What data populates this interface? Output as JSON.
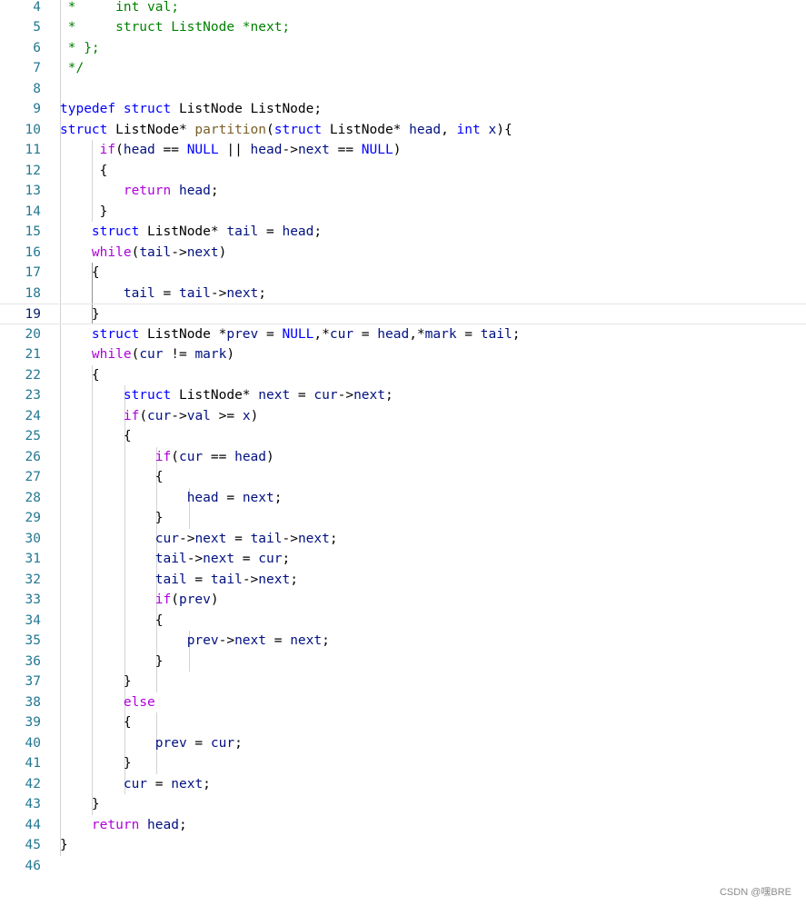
{
  "editor": {
    "language": "c",
    "first_line": 4,
    "current_line": 19,
    "colors": {
      "kw": "#0000ff",
      "ctl": "#af00db",
      "fn": "#795e26",
      "var": "#001080",
      "cm": "#008000",
      "pl": "#000000",
      "line_number": "#237893",
      "line_number_active": "#0b216f"
    },
    "lines": [
      {
        "number": "4",
        "indent": "",
        "tokens": [
          [
            "cm",
            " *     int val;"
          ]
        ]
      },
      {
        "number": "5",
        "indent": "",
        "tokens": [
          [
            "cm",
            " *     struct ListNode *next;"
          ]
        ]
      },
      {
        "number": "6",
        "indent": "",
        "tokens": [
          [
            "cm",
            " * };"
          ]
        ]
      },
      {
        "number": "7",
        "indent": "",
        "tokens": [
          [
            "cm",
            " */"
          ]
        ]
      },
      {
        "number": "8",
        "indent": "",
        "tokens": []
      },
      {
        "number": "9",
        "indent": "",
        "tokens": [
          [
            "kw",
            "typedef"
          ],
          [
            "pl",
            " "
          ],
          [
            "kw",
            "struct"
          ],
          [
            "pl",
            " ListNode ListNode;"
          ]
        ]
      },
      {
        "number": "10",
        "indent": "",
        "tokens": [
          [
            "kw",
            "struct"
          ],
          [
            "pl",
            " ListNode* "
          ],
          [
            "fn",
            "partition"
          ],
          [
            "pl",
            "("
          ],
          [
            "kw",
            "struct"
          ],
          [
            "pl",
            " ListNode* "
          ],
          [
            "var",
            "head"
          ],
          [
            "pl",
            ", "
          ],
          [
            "kw",
            "int"
          ],
          [
            "pl",
            " "
          ],
          [
            "var",
            "x"
          ],
          [
            "pl",
            "){"
          ]
        ]
      },
      {
        "number": "11",
        "indent": "     ",
        "tokens": [
          [
            "ctl",
            "if"
          ],
          [
            "pl",
            "("
          ],
          [
            "var",
            "head"
          ],
          [
            "pl",
            " == "
          ],
          [
            "kw",
            "NULL"
          ],
          [
            "pl",
            " || "
          ],
          [
            "var",
            "head"
          ],
          [
            "pl",
            "->"
          ],
          [
            "var",
            "next"
          ],
          [
            "pl",
            " == "
          ],
          [
            "kw",
            "NULL"
          ],
          [
            "pl",
            ")"
          ]
        ]
      },
      {
        "number": "12",
        "indent": "     ",
        "tokens": [
          [
            "pl",
            "{"
          ]
        ]
      },
      {
        "number": "13",
        "indent": "        ",
        "tokens": [
          [
            "ctl",
            "return"
          ],
          [
            "pl",
            " "
          ],
          [
            "var",
            "head"
          ],
          [
            "pl",
            ";"
          ]
        ]
      },
      {
        "number": "14",
        "indent": "     ",
        "tokens": [
          [
            "pl",
            "}"
          ]
        ]
      },
      {
        "number": "15",
        "indent": "    ",
        "tokens": [
          [
            "kw",
            "struct"
          ],
          [
            "pl",
            " ListNode* "
          ],
          [
            "var",
            "tail"
          ],
          [
            "pl",
            " = "
          ],
          [
            "var",
            "head"
          ],
          [
            "pl",
            ";"
          ]
        ]
      },
      {
        "number": "16",
        "indent": "    ",
        "tokens": [
          [
            "ctl",
            "while"
          ],
          [
            "pl",
            "("
          ],
          [
            "var",
            "tail"
          ],
          [
            "pl",
            "->"
          ],
          [
            "var",
            "next"
          ],
          [
            "pl",
            ")"
          ]
        ]
      },
      {
        "number": "17",
        "indent": "    ",
        "tokens": [
          [
            "pl",
            "{"
          ]
        ]
      },
      {
        "number": "18",
        "indent": "        ",
        "tokens": [
          [
            "var",
            "tail"
          ],
          [
            "pl",
            " = "
          ],
          [
            "var",
            "tail"
          ],
          [
            "pl",
            "->"
          ],
          [
            "var",
            "next"
          ],
          [
            "pl",
            ";"
          ]
        ]
      },
      {
        "number": "19",
        "indent": "    ",
        "tokens": [
          [
            "pl",
            "}"
          ]
        ]
      },
      {
        "number": "20",
        "indent": "    ",
        "tokens": [
          [
            "kw",
            "struct"
          ],
          [
            "pl",
            " ListNode *"
          ],
          [
            "var",
            "prev"
          ],
          [
            "pl",
            " = "
          ],
          [
            "kw",
            "NULL"
          ],
          [
            "pl",
            ",*"
          ],
          [
            "var",
            "cur"
          ],
          [
            "pl",
            " = "
          ],
          [
            "var",
            "head"
          ],
          [
            "pl",
            ",*"
          ],
          [
            "var",
            "mark"
          ],
          [
            "pl",
            " = "
          ],
          [
            "var",
            "tail"
          ],
          [
            "pl",
            ";"
          ]
        ]
      },
      {
        "number": "21",
        "indent": "    ",
        "tokens": [
          [
            "ctl",
            "while"
          ],
          [
            "pl",
            "("
          ],
          [
            "var",
            "cur"
          ],
          [
            "pl",
            " != "
          ],
          [
            "var",
            "mark"
          ],
          [
            "pl",
            ")"
          ]
        ]
      },
      {
        "number": "22",
        "indent": "    ",
        "tokens": [
          [
            "pl",
            "{"
          ]
        ]
      },
      {
        "number": "23",
        "indent": "        ",
        "tokens": [
          [
            "kw",
            "struct"
          ],
          [
            "pl",
            " ListNode* "
          ],
          [
            "var",
            "next"
          ],
          [
            "pl",
            " = "
          ],
          [
            "var",
            "cur"
          ],
          [
            "pl",
            "->"
          ],
          [
            "var",
            "next"
          ],
          [
            "pl",
            ";"
          ]
        ]
      },
      {
        "number": "24",
        "indent": "        ",
        "tokens": [
          [
            "ctl",
            "if"
          ],
          [
            "pl",
            "("
          ],
          [
            "var",
            "cur"
          ],
          [
            "pl",
            "->"
          ],
          [
            "var",
            "val"
          ],
          [
            "pl",
            " >= "
          ],
          [
            "var",
            "x"
          ],
          [
            "pl",
            ")"
          ]
        ]
      },
      {
        "number": "25",
        "indent": "        ",
        "tokens": [
          [
            "pl",
            "{"
          ]
        ]
      },
      {
        "number": "26",
        "indent": "            ",
        "tokens": [
          [
            "ctl",
            "if"
          ],
          [
            "pl",
            "("
          ],
          [
            "var",
            "cur"
          ],
          [
            "pl",
            " == "
          ],
          [
            "var",
            "head"
          ],
          [
            "pl",
            ")"
          ]
        ]
      },
      {
        "number": "27",
        "indent": "            ",
        "tokens": [
          [
            "pl",
            "{"
          ]
        ]
      },
      {
        "number": "28",
        "indent": "                ",
        "tokens": [
          [
            "var",
            "head"
          ],
          [
            "pl",
            " = "
          ],
          [
            "var",
            "next"
          ],
          [
            "pl",
            ";"
          ]
        ]
      },
      {
        "number": "29",
        "indent": "            ",
        "tokens": [
          [
            "pl",
            "}"
          ]
        ]
      },
      {
        "number": "30",
        "indent": "            ",
        "tokens": [
          [
            "var",
            "cur"
          ],
          [
            "pl",
            "->"
          ],
          [
            "var",
            "next"
          ],
          [
            "pl",
            " = "
          ],
          [
            "var",
            "tail"
          ],
          [
            "pl",
            "->"
          ],
          [
            "var",
            "next"
          ],
          [
            "pl",
            ";"
          ]
        ]
      },
      {
        "number": "31",
        "indent": "            ",
        "tokens": [
          [
            "var",
            "tail"
          ],
          [
            "pl",
            "->"
          ],
          [
            "var",
            "next"
          ],
          [
            "pl",
            " = "
          ],
          [
            "var",
            "cur"
          ],
          [
            "pl",
            ";"
          ]
        ]
      },
      {
        "number": "32",
        "indent": "            ",
        "tokens": [
          [
            "var",
            "tail"
          ],
          [
            "pl",
            " = "
          ],
          [
            "var",
            "tail"
          ],
          [
            "pl",
            "->"
          ],
          [
            "var",
            "next"
          ],
          [
            "pl",
            ";"
          ]
        ]
      },
      {
        "number": "33",
        "indent": "            ",
        "tokens": [
          [
            "ctl",
            "if"
          ],
          [
            "pl",
            "("
          ],
          [
            "var",
            "prev"
          ],
          [
            "pl",
            ")"
          ]
        ]
      },
      {
        "number": "34",
        "indent": "            ",
        "tokens": [
          [
            "pl",
            "{"
          ]
        ]
      },
      {
        "number": "35",
        "indent": "                ",
        "tokens": [
          [
            "var",
            "prev"
          ],
          [
            "pl",
            "->"
          ],
          [
            "var",
            "next"
          ],
          [
            "pl",
            " = "
          ],
          [
            "var",
            "next"
          ],
          [
            "pl",
            ";"
          ]
        ]
      },
      {
        "number": "36",
        "indent": "            ",
        "tokens": [
          [
            "pl",
            "}"
          ]
        ]
      },
      {
        "number": "37",
        "indent": "        ",
        "tokens": [
          [
            "pl",
            "}"
          ]
        ]
      },
      {
        "number": "38",
        "indent": "        ",
        "tokens": [
          [
            "ctl",
            "else"
          ]
        ]
      },
      {
        "number": "39",
        "indent": "        ",
        "tokens": [
          [
            "pl",
            "{"
          ]
        ]
      },
      {
        "number": "40",
        "indent": "            ",
        "tokens": [
          [
            "var",
            "prev"
          ],
          [
            "pl",
            " = "
          ],
          [
            "var",
            "cur"
          ],
          [
            "pl",
            ";"
          ]
        ]
      },
      {
        "number": "41",
        "indent": "        ",
        "tokens": [
          [
            "pl",
            "}"
          ]
        ]
      },
      {
        "number": "42",
        "indent": "        ",
        "tokens": [
          [
            "var",
            "cur"
          ],
          [
            "pl",
            " = "
          ],
          [
            "var",
            "next"
          ],
          [
            "pl",
            ";"
          ]
        ]
      },
      {
        "number": "43",
        "indent": "    ",
        "tokens": [
          [
            "pl",
            "}"
          ]
        ]
      },
      {
        "number": "44",
        "indent": "    ",
        "tokens": [
          [
            "ctl",
            "return"
          ],
          [
            "pl",
            " "
          ],
          [
            "var",
            "head"
          ],
          [
            "pl",
            ";"
          ]
        ]
      },
      {
        "number": "45",
        "indent": "",
        "tokens": [
          [
            "pl",
            "}"
          ]
        ]
      },
      {
        "number": "46",
        "indent": "",
        "tokens": []
      }
    ]
  },
  "watermark": "CSDN @嘿BRE"
}
